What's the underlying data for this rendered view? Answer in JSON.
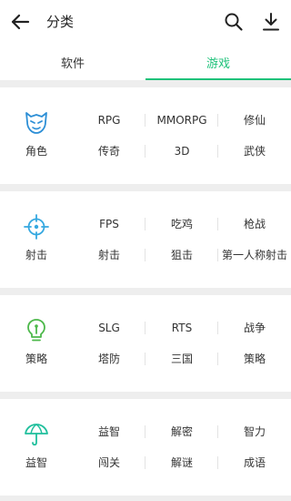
{
  "header": {
    "title": "分类",
    "back_icon": "back-arrow-icon",
    "search_icon": "search-icon",
    "download_icon": "download-icon"
  },
  "tabs": [
    {
      "label": "软件",
      "active": false
    },
    {
      "label": "游戏",
      "active": true
    }
  ],
  "accent_color": "#1ec27a",
  "sections": [
    {
      "icon": "mask-icon",
      "icon_color": "#2d8fd6",
      "main_label": "角色",
      "tags": [
        "RPG",
        "MMORPG",
        "修仙",
        "传奇",
        "3D",
        "武侠"
      ]
    },
    {
      "icon": "crosshair-icon",
      "icon_color": "#35a8e0",
      "main_label": "射击",
      "tags": [
        "FPS",
        "吃鸡",
        "枪战",
        "射击",
        "狙击",
        "第一人称射击"
      ]
    },
    {
      "icon": "lightbulb-icon",
      "icon_color": "#4cb84a",
      "main_label": "策略",
      "tags": [
        "SLG",
        "RTS",
        "战争",
        "塔防",
        "三国",
        "策略"
      ]
    },
    {
      "icon": "umbrella-icon",
      "icon_color": "#1fbf9c",
      "main_label": "益智",
      "tags": [
        "益智",
        "解密",
        "智力",
        "闯关",
        "解谜",
        "成语"
      ]
    }
  ]
}
